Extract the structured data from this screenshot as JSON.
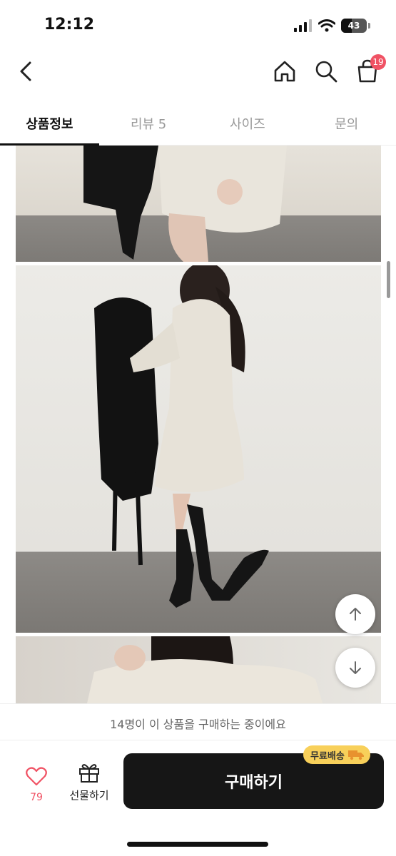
{
  "status_bar": {
    "time": "12:12",
    "battery": "43"
  },
  "header": {
    "cart_badge": "19"
  },
  "tabs": [
    {
      "label": "상품정보",
      "active": true
    },
    {
      "label": "리뷰 5",
      "active": false
    },
    {
      "label": "사이즈",
      "active": false
    },
    {
      "label": "문의",
      "active": false
    }
  ],
  "notice": {
    "text": "14명이 이 상품을 구매하는 중이에요"
  },
  "bottom_bar": {
    "like_count": "79",
    "gift_label": "선물하기",
    "buy_label": "구매하기",
    "shipping_badge": "무료배송"
  },
  "colors": {
    "accent": "#f05264",
    "button": "#161616",
    "badge_yellow": "#f8d05a"
  }
}
